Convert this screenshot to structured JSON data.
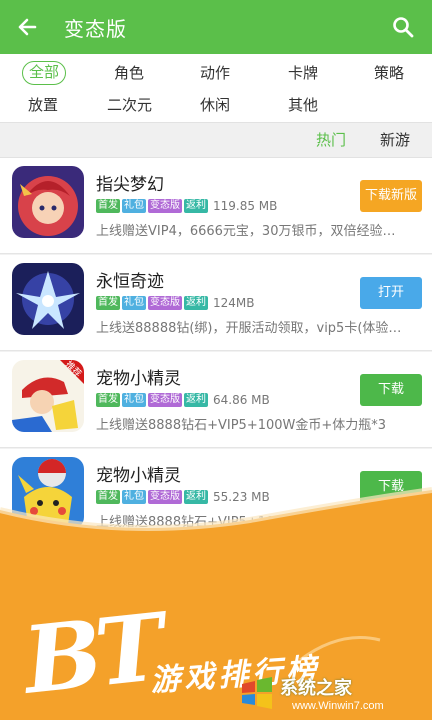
{
  "header": {
    "title": "变态版"
  },
  "categories": [
    "全部",
    "角色",
    "动作",
    "卡牌",
    "策略",
    "放置",
    "二次元",
    "休闲",
    "其他"
  ],
  "sort_tabs": [
    "热门",
    "新游"
  ],
  "tag_labels": {
    "first": "首发",
    "gift": "礼包",
    "bt": "变态版",
    "rebate": "返利"
  },
  "tag_colors": {
    "first": "#4fb85c",
    "gift": "#4fb0e0",
    "bt": "#b06ad6",
    "rebate": "#36b8a5"
  },
  "apps": [
    {
      "name": "指尖梦幻",
      "size": "119.85 MB",
      "desc": "上线赠送VIP4，6666元宝，30万银币，双倍经验…",
      "button": "下载新版",
      "button_color": "orange",
      "badge": ""
    },
    {
      "name": "永恒奇迹",
      "size": "124MB",
      "desc": "上线送88888钻(绑)，开服活动领取，vip5卡(体验…",
      "button": "打开",
      "button_color": "blue",
      "badge": ""
    },
    {
      "name": "宠物小精灵",
      "size": "64.86 MB",
      "desc": "上线赠送8888钻石+VIP5+100W金币+体力瓶*3",
      "button": "下载",
      "button_color": "green",
      "badge": "推荐"
    },
    {
      "name": "宠物小精灵",
      "size": "55.23 MB",
      "desc": "上线赠送8888钻石+VIP5+100W金币+体…",
      "button": "下载",
      "button_color": "green",
      "badge": ""
    }
  ],
  "banner": {
    "letters": "BT",
    "caption": "游戏排行榜"
  },
  "watermark": {
    "cn": "系统之家",
    "url": "www.Winwin7.com"
  }
}
